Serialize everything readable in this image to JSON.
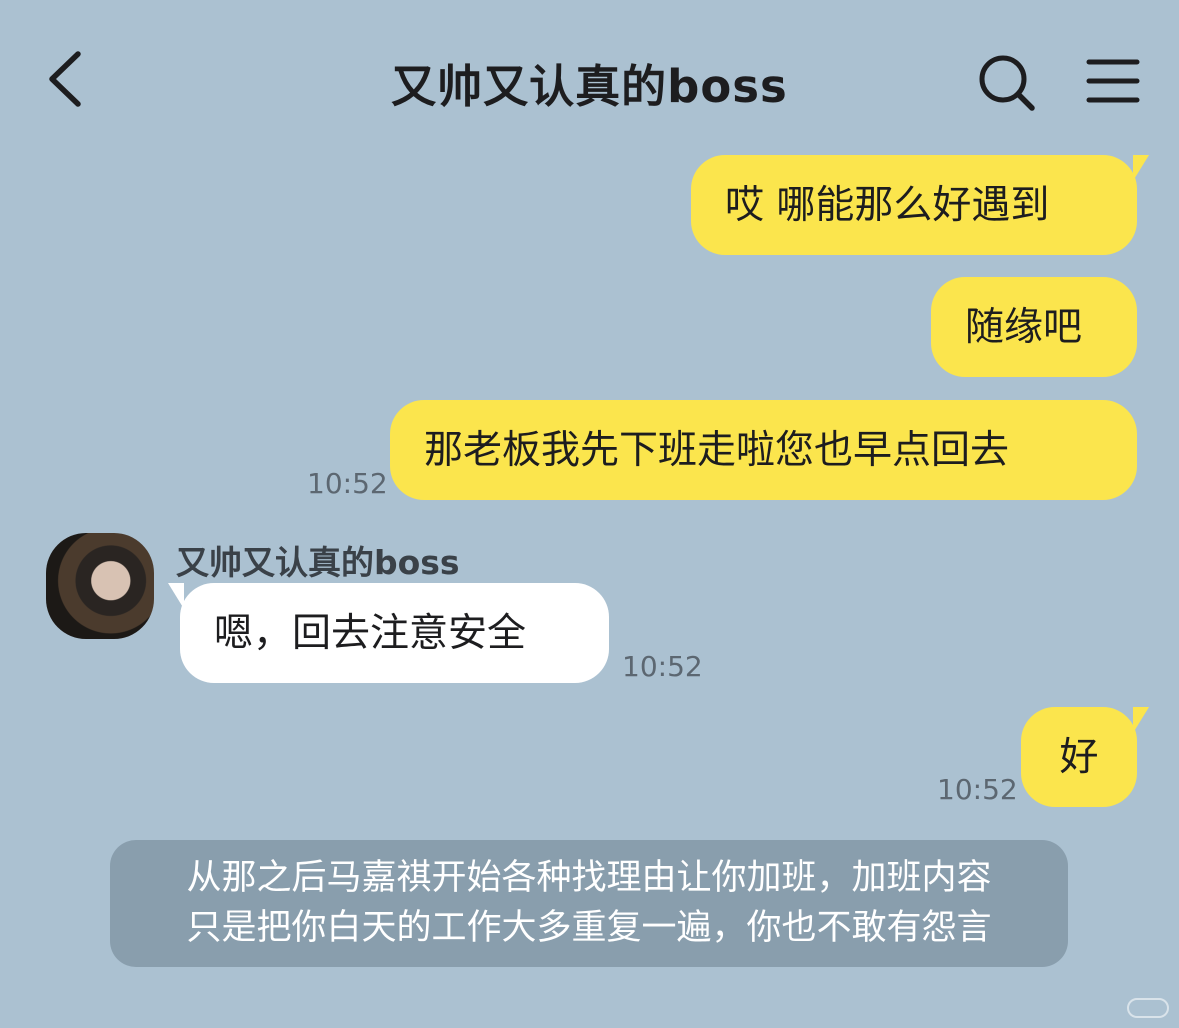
{
  "header": {
    "title": "又帅又认真的boss",
    "back_icon": "chevron-left-icon",
    "search_icon": "search-icon",
    "menu_icon": "hamburger-menu-icon"
  },
  "messages": [
    {
      "side": "me",
      "text": "哎 哪能那么好遇到"
    },
    {
      "side": "me",
      "text": "随缘吧"
    },
    {
      "side": "me",
      "text": "那老板我先下班走啦您也早点回去",
      "time": "10:52"
    },
    {
      "side": "them",
      "sender": "又帅又认真的boss",
      "text": "嗯，回去注意安全",
      "time": "10:52"
    },
    {
      "side": "me",
      "text": "好",
      "time": "10:52"
    }
  ],
  "narration": {
    "line1": "从那之后马嘉祺开始各种找理由让你加班，加班内容",
    "line2": "只是把你白天的工作大多重复一遍，你也不敢有怨言"
  },
  "colors": {
    "background": "#abc1d1",
    "my_bubble": "#fbe54d",
    "their_bubble": "#ffffff"
  }
}
